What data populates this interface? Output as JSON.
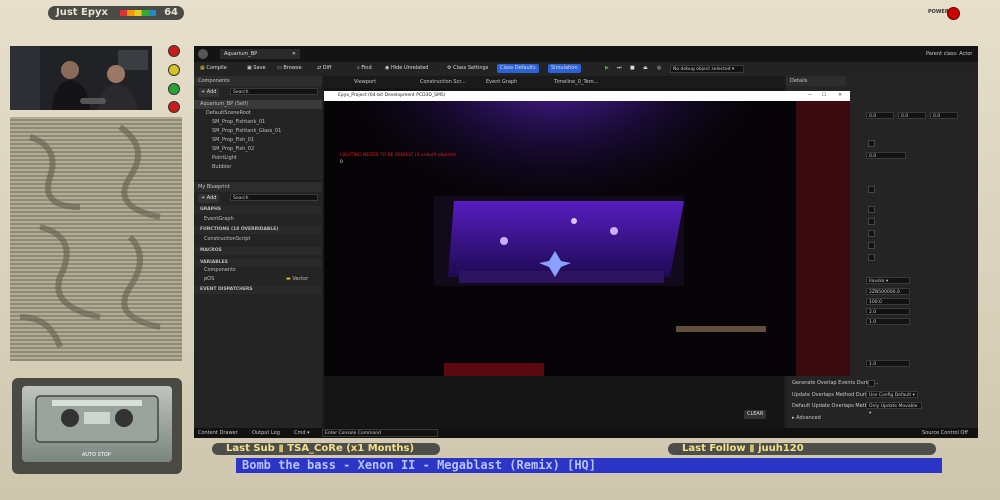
{
  "overlay": {
    "channel_name": "Just Epyx",
    "channel_number": "64",
    "power_label": "POWER",
    "cassette_label": "AUTO STOP",
    "last_sub": {
      "label": "Last Sub",
      "value": "TSA_CoRe (x1 Months)"
    },
    "last_follow": {
      "label": "Last Follow",
      "value": "juuh120"
    },
    "now_playing": "Bomb the bass - Xenon II - Megablast (Remix) [HQ]"
  },
  "editor": {
    "asset_tab": "Aquarium_BP",
    "parent_class_label": "Parent class:",
    "parent_class_value": "Actor",
    "toolbar": {
      "compile": "Compile",
      "save": "Save",
      "browse": "Browse",
      "diff": "Diff",
      "find": "Find",
      "hide_unrelated": "Hide Unrelated",
      "class_settings": "Class Settings",
      "class_defaults": "Class Defaults",
      "simulation": "Simulation",
      "debug_select": "No debug object selected"
    },
    "components": {
      "title": "Components",
      "add": "+ Add",
      "search_placeholder": "Search",
      "items": [
        "Aquarium_BP (Self)",
        "DefaultSceneRoot",
        "SM_Prop_Fishtank_01",
        "SM_Prop_Fishtank_Glass_01",
        "SM_Prop_Fish_01",
        "SM_Prop_Fish_02",
        "PointLight",
        "Bubbler"
      ]
    },
    "my_blueprint": {
      "title": "My Blueprint",
      "add": "+ Add",
      "search_placeholder": "Search",
      "graphs_label": "GRAPHS",
      "event_graph": "EventGraph",
      "functions_label": "FUNCTIONS",
      "functions_count": "(18 OVERRIDABLE)",
      "construction_script": "ConstructionScript",
      "macros_label": "MACROS",
      "variables_label": "VARIABLES",
      "components_label": "Components",
      "var_name": "pOS",
      "var_type": "Vector",
      "dispatchers_label": "EVENT DISPATCHERS"
    },
    "doc_tabs": [
      "Viewport",
      "Construction Scr...",
      "Event Graph",
      "Timeline_0_Tem..."
    ],
    "details": {
      "title": "Details",
      "xyz": [
        "0.0",
        "0.0",
        "0.0"
      ],
      "value_a": "0.0",
      "dropdown_value": "Ilovsko",
      "field_values": [
        "2ZN500000.0",
        "100.0",
        "2.0",
        "1.0"
      ],
      "value_b": "1.0",
      "generate_overlap": "Generate Overlap Events During...",
      "update_overlap": "Update Overlaps Method During...",
      "update_overlap_value": "Use Config Default",
      "default_update": "Default Update Overlaps Metho...",
      "default_update_value": "Only Update Movable",
      "advanced": "Advanced"
    },
    "game_window": {
      "title": "Epyx_Project (64-bit Development PCD3D_SM5)",
      "warning": "LIGHTING NEEDS TO BE REBUILT (3 unbuilt objects)",
      "counter": "0"
    },
    "bottom": {
      "content_drawer": "Content Drawer",
      "output_log": "Output Log",
      "cmd": "Cmd",
      "console_placeholder": "Enter Console Command",
      "source_control": "Source Control Off",
      "clear": "CLEAR"
    }
  },
  "colors": {
    "accent_blue": "#2b62d6",
    "ticker_bg": "#2b36c8",
    "ticker_text": "#b8c2ff",
    "frame_bg": "#d8d0bb",
    "lamp_red": "#cc1a1a",
    "lamp_yellow": "#d6c21d",
    "lamp_green": "#27a333"
  }
}
